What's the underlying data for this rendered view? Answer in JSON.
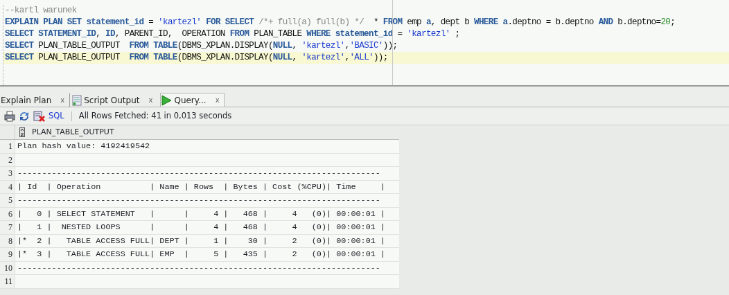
{
  "editor": {
    "lines": [
      {
        "current": false,
        "tokens": [
          {
            "kind": "comment",
            "text": "--kartl warunek"
          }
        ]
      },
      {
        "current": false,
        "tokens": [
          {
            "kind": "keyword",
            "text": "EXPLAIN PLAN SET statement_id"
          },
          {
            "kind": "plain",
            "text": " = "
          },
          {
            "kind": "string",
            "text": "'kartezl' "
          },
          {
            "kind": "keyword",
            "text": "FOR SELECT "
          },
          {
            "kind": "comment",
            "text": "/*+ full(a) full(b) */"
          },
          {
            "kind": "plain",
            "text": "  * "
          },
          {
            "kind": "keyword",
            "text": "FROM"
          },
          {
            "kind": "plain",
            "text": " emp "
          },
          {
            "kind": "keyword",
            "text": "a"
          },
          {
            "kind": "plain",
            "text": ", dept b "
          },
          {
            "kind": "keyword",
            "text": "WHERE a"
          },
          {
            "kind": "plain",
            "text": ".deptno = b.deptno "
          },
          {
            "kind": "keyword",
            "text": "AND"
          },
          {
            "kind": "plain",
            "text": " b.deptno="
          },
          {
            "kind": "number",
            "text": "20"
          },
          {
            "kind": "plain",
            "text": ";"
          }
        ]
      },
      {
        "current": false,
        "tokens": [
          {
            "kind": "keyword",
            "text": "SELECT STATEMENT_ID"
          },
          {
            "kind": "plain",
            "text": ", "
          },
          {
            "kind": "keyword",
            "text": "ID"
          },
          {
            "kind": "plain",
            "text": ", PARENT_ID,  OPERATION "
          },
          {
            "kind": "keyword",
            "text": "FROM"
          },
          {
            "kind": "plain",
            "text": " PLAN_TABLE "
          },
          {
            "kind": "keyword",
            "text": "WHERE statement_id"
          },
          {
            "kind": "plain",
            "text": " = "
          },
          {
            "kind": "string",
            "text": "'kartezl'"
          },
          {
            "kind": "plain",
            "text": " ;"
          }
        ]
      },
      {
        "current": false,
        "tokens": [
          {
            "kind": "keyword",
            "text": "SELECT"
          },
          {
            "kind": "plain",
            "text": " PLAN_TABLE_OUTPUT  "
          },
          {
            "kind": "keyword",
            "text": "FROM TABLE"
          },
          {
            "kind": "plain",
            "text": "(DBMS_XPLAN.DISPLAY("
          },
          {
            "kind": "keyword",
            "text": "NULL"
          },
          {
            "kind": "plain",
            "text": ", "
          },
          {
            "kind": "string",
            "text": "'kartezl'"
          },
          {
            "kind": "plain",
            "text": ","
          },
          {
            "kind": "string",
            "text": "'BASIC'"
          },
          {
            "kind": "plain",
            "text": "));"
          }
        ]
      },
      {
        "current": true,
        "tokens": [
          {
            "kind": "keyword",
            "text": "SELECT"
          },
          {
            "kind": "plain",
            "text": " PLAN_TABLE_OUTPUT  "
          },
          {
            "kind": "keyword",
            "text": "FROM TABLE"
          },
          {
            "kind": "plain",
            "text": "(DBMS_XPLAN.DISPLAY("
          },
          {
            "kind": "keyword",
            "text": "NULL"
          },
          {
            "kind": "plain",
            "text": ", "
          },
          {
            "kind": "string",
            "text": "'kartezl'"
          },
          {
            "kind": "plain",
            "text": ","
          },
          {
            "kind": "string",
            "text": "'ALL'"
          },
          {
            "kind": "plain",
            "text": "));"
          }
        ]
      }
    ]
  },
  "tabs": [
    {
      "label": "Explain Plan",
      "close": "x",
      "kind": "plain",
      "selected": false
    },
    {
      "label": "Script Output",
      "close": "x",
      "kind": "script",
      "selected": false
    },
    {
      "label": "Query...",
      "close": "x",
      "kind": "query",
      "selected": true
    }
  ],
  "toolbar": {
    "sql_link": "SQL",
    "status": "All Rows Fetched: 41 in 0,013 seconds"
  },
  "grid": {
    "column": "PLAN_TABLE_OUTPUT",
    "rows": [
      {
        "number": "1",
        "value": "Plan hash value: 4192419542"
      },
      {
        "number": "2"
      },
      {
        "number": "3",
        "value": "--------------------------------------------------------------------------"
      },
      {
        "number": "4",
        "value": "| Id  | Operation          | Name | Rows  | Bytes | Cost (%CPU)| Time     |"
      },
      {
        "number": "5",
        "value": "--------------------------------------------------------------------------"
      },
      {
        "number": "6",
        "value": "|   0 | SELECT STATEMENT   |      |     4 |   468 |     4   (0)| 00:00:01 |"
      },
      {
        "number": "7",
        "value": "|   1 |  NESTED LOOPS      |      |     4 |   468 |     4   (0)| 00:00:01 |"
      },
      {
        "number": "8",
        "value": "|*  2 |   TABLE ACCESS FULL| DEPT |     1 |    30 |     2   (0)| 00:00:01 |"
      },
      {
        "number": "9",
        "value": "|*  3 |   TABLE ACCESS FULL| EMP  |     5 |   435 |     2   (0)| 00:00:01 |"
      },
      {
        "number": "10",
        "value": "--------------------------------------------------------------------------"
      },
      {
        "number": "11"
      }
    ]
  }
}
